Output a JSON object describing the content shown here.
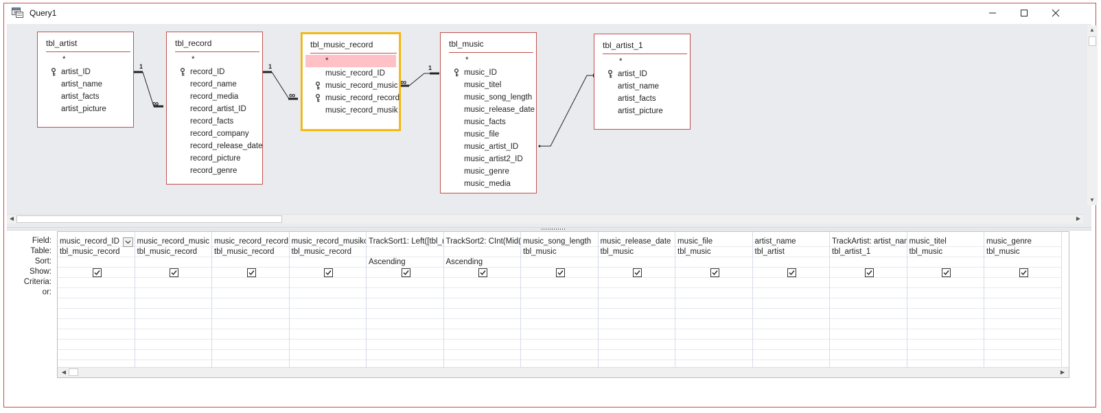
{
  "window": {
    "title": "Query1"
  },
  "tables": [
    {
      "title": "tbl_artist",
      "fields": [
        {
          "name": "*",
          "key": false,
          "star": true
        },
        {
          "name": "artist_ID",
          "key": true
        },
        {
          "name": "artist_name",
          "key": false
        },
        {
          "name": "artist_facts",
          "key": false
        },
        {
          "name": "artist_picture",
          "key": false
        }
      ]
    },
    {
      "title": "tbl_record",
      "fields": [
        {
          "name": "*",
          "key": false,
          "star": true
        },
        {
          "name": "record_ID",
          "key": true
        },
        {
          "name": "record_name",
          "key": false
        },
        {
          "name": "record_media",
          "key": false
        },
        {
          "name": "record_artist_ID",
          "key": false
        },
        {
          "name": "record_facts",
          "key": false
        },
        {
          "name": "record_company",
          "key": false
        },
        {
          "name": "record_release_date",
          "key": false
        },
        {
          "name": "record_picture",
          "key": false
        },
        {
          "name": "record_genre",
          "key": false
        }
      ]
    },
    {
      "title": "tbl_music_record",
      "fields": [
        {
          "name": "*",
          "key": false,
          "star": true,
          "highlight": true
        },
        {
          "name": "music_record_ID",
          "key": false
        },
        {
          "name": "music_record_music",
          "key": true
        },
        {
          "name": "music_record_record",
          "key": true
        },
        {
          "name": "music_record_musik",
          "key": false
        }
      ]
    },
    {
      "title": "tbl_music",
      "fields": [
        {
          "name": "*",
          "key": false,
          "star": true
        },
        {
          "name": "music_ID",
          "key": true
        },
        {
          "name": "music_titel",
          "key": false
        },
        {
          "name": "music_song_length",
          "key": false
        },
        {
          "name": "music_release_date",
          "key": false
        },
        {
          "name": "music_facts",
          "key": false
        },
        {
          "name": "music_file",
          "key": false
        },
        {
          "name": "music_artist_ID",
          "key": false
        },
        {
          "name": "music_artist2_ID",
          "key": false
        },
        {
          "name": "music_genre",
          "key": false
        },
        {
          "name": "music_media",
          "key": false
        }
      ]
    },
    {
      "title": "tbl_artist_1",
      "fields": [
        {
          "name": "*",
          "key": false,
          "star": true
        },
        {
          "name": "artist_ID",
          "key": true
        },
        {
          "name": "artist_name",
          "key": false
        },
        {
          "name": "artist_facts",
          "key": false
        },
        {
          "name": "artist_picture",
          "key": false
        }
      ]
    }
  ],
  "relationships": [
    {
      "one": "1",
      "many": "∞"
    },
    {
      "one": "1",
      "many": "∞"
    },
    {
      "one": "1",
      "many": "∞"
    }
  ],
  "row_labels": [
    "Field:",
    "Table:",
    "Sort:",
    "Show:",
    "Criteria:",
    "or:"
  ],
  "columns": [
    {
      "field": "music_record_ID",
      "table": "tbl_music_record",
      "sort": "",
      "show": true
    },
    {
      "field": "music_record_music",
      "table": "tbl_music_record",
      "sort": "",
      "show": true
    },
    {
      "field": "music_record_record",
      "table": "tbl_music_record",
      "sort": "",
      "show": true
    },
    {
      "field": "music_record_musiko",
      "table": "tbl_music_record",
      "sort": "",
      "show": true
    },
    {
      "field": "TrackSort1: Left([tbl_m",
      "table": "",
      "sort": "Ascending",
      "show": true
    },
    {
      "field": "TrackSort2: CInt(Mid([",
      "table": "",
      "sort": "Ascending",
      "show": true
    },
    {
      "field": "music_song_length",
      "table": "tbl_music",
      "sort": "",
      "show": true
    },
    {
      "field": "music_release_date",
      "table": "tbl_music",
      "sort": "",
      "show": true
    },
    {
      "field": "music_file",
      "table": "tbl_music",
      "sort": "",
      "show": true
    },
    {
      "field": "artist_name",
      "table": "tbl_artist",
      "sort": "",
      "show": true
    },
    {
      "field": "TrackArtist: artist_nam",
      "table": "tbl_artist_1",
      "sort": "",
      "show": true
    },
    {
      "field": "music_titel",
      "table": "tbl_music",
      "sort": "",
      "show": true
    },
    {
      "field": "music_genre",
      "table": "tbl_music",
      "sort": "",
      "show": true
    }
  ]
}
